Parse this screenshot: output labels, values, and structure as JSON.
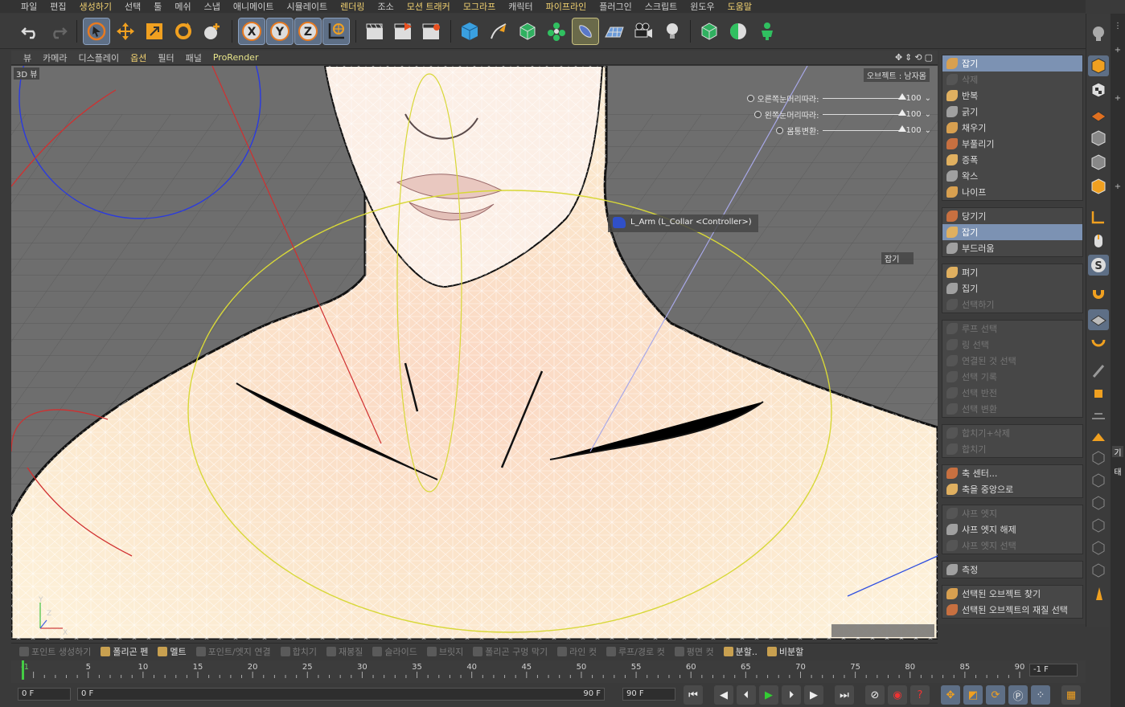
{
  "menubar": {
    "items": [
      {
        "label": "파일"
      },
      {
        "label": "편집"
      },
      {
        "label": "생성하기",
        "hl": true
      },
      {
        "label": "선택"
      },
      {
        "label": "툴"
      },
      {
        "label": "메쉬"
      },
      {
        "label": "스냅"
      },
      {
        "label": "애니메이트"
      },
      {
        "label": "시뮬레이트"
      },
      {
        "label": "렌더링",
        "hl": true
      },
      {
        "label": "조소"
      },
      {
        "label": "모션 트래커",
        "hl": true
      },
      {
        "label": "모그라프",
        "hl": true
      },
      {
        "label": "캐릭터"
      },
      {
        "label": "파이프라인",
        "hl": true
      },
      {
        "label": "플러그인"
      },
      {
        "label": "스크립트"
      },
      {
        "label": "윈도우"
      },
      {
        "label": "도움말",
        "hl": true
      }
    ]
  },
  "viewport_menu": {
    "items": [
      "뷰",
      "카메라",
      "디스플레이",
      "옵션",
      "필터",
      "패널"
    ],
    "highlight_index": 3,
    "prorender": "ProRender"
  },
  "viewport": {
    "label": "3D 뷰",
    "object_label": "오브젝트 : 남자몸",
    "sliders": [
      {
        "label": "오른쪽눈머리따라:",
        "value": "100"
      },
      {
        "label": "왼쪽눈머리따라:",
        "value": "100"
      },
      {
        "label": "몸통변환:",
        "value": "100"
      }
    ],
    "tooltip": "L_Arm (L_Collar <Controller>)",
    "grab_tag": "잡기",
    "axis_y": "Y",
    "axis_z": "Z",
    "axis_x": "X"
  },
  "command_panel": {
    "groups": [
      {
        "items": [
          {
            "label": "잡기",
            "sel": true
          },
          {
            "label": "삭제",
            "dis": true
          },
          {
            "label": "반복"
          },
          {
            "label": "긁기"
          },
          {
            "label": "채우기"
          },
          {
            "label": "부풀리기"
          },
          {
            "label": "증폭"
          },
          {
            "label": "왁스"
          },
          {
            "label": "나이프"
          }
        ]
      },
      {
        "items": [
          {
            "label": "당기기"
          },
          {
            "label": "잡기",
            "sel": true
          },
          {
            "label": "부드러움"
          }
        ]
      },
      {
        "items": [
          {
            "label": "펴기"
          },
          {
            "label": "집기"
          },
          {
            "label": "선택하기",
            "dis": true
          }
        ]
      },
      {
        "items": [
          {
            "label": "루프 선택",
            "dis": true
          },
          {
            "label": "링 선택",
            "dis": true
          },
          {
            "label": "연결된 것 선택",
            "dis": true
          },
          {
            "label": "선택 기록",
            "dis": true
          },
          {
            "label": "선택 반전",
            "dis": true
          },
          {
            "label": "선택 변환",
            "dis": true
          }
        ]
      },
      {
        "items": [
          {
            "label": "합치기+삭제",
            "dis": true
          },
          {
            "label": "합치기",
            "dis": true
          }
        ]
      },
      {
        "items": [
          {
            "label": "축 센터..."
          },
          {
            "label": "축을 중앙으로"
          }
        ]
      },
      {
        "items": [
          {
            "label": "샤프 엣지",
            "dis": true
          },
          {
            "label": "샤프 엣지 해제"
          },
          {
            "label": "샤프 엣지 선택",
            "dis": true
          }
        ]
      },
      {
        "items": [
          {
            "label": "측정"
          }
        ]
      },
      {
        "items": [
          {
            "label": "선택된 오브젝트 찾기"
          },
          {
            "label": "선택된 오브젝트의 재질 선택"
          }
        ]
      }
    ]
  },
  "polybar": {
    "items": [
      {
        "label": "포인트 생성하기",
        "on": false
      },
      {
        "label": "폴리곤 펜",
        "on": true
      },
      {
        "label": "멜트",
        "on": true
      },
      {
        "label": "포인트/엣지 연결",
        "on": false
      },
      {
        "label": "합치기",
        "on": false
      },
      {
        "label": "재봉질",
        "on": false
      },
      {
        "label": "슬라이드",
        "on": false
      },
      {
        "label": "브릿지",
        "on": false
      },
      {
        "label": "폴리곤 구멍 막기",
        "on": false
      },
      {
        "label": "라인 컷",
        "on": false
      },
      {
        "label": "루프/경로 컷",
        "on": false
      },
      {
        "label": "평면 컷",
        "on": false
      },
      {
        "label": "분할..",
        "on": true
      },
      {
        "label": "비분할",
        "on": true
      }
    ]
  },
  "timeline": {
    "ticks": [
      "5",
      "10",
      "15",
      "20",
      "25",
      "30",
      "35",
      "40",
      "45",
      "50",
      "55",
      "60",
      "65",
      "70",
      "75",
      "80",
      "85",
      "90"
    ],
    "start_mark": "-1",
    "current": "-1 F"
  },
  "transport": {
    "start_field": "0 F",
    "range_start": "0 F",
    "range_end": "90 F",
    "end_field": "90 F"
  },
  "farstrip": {
    "tab1": "기",
    "tab2": "태"
  }
}
